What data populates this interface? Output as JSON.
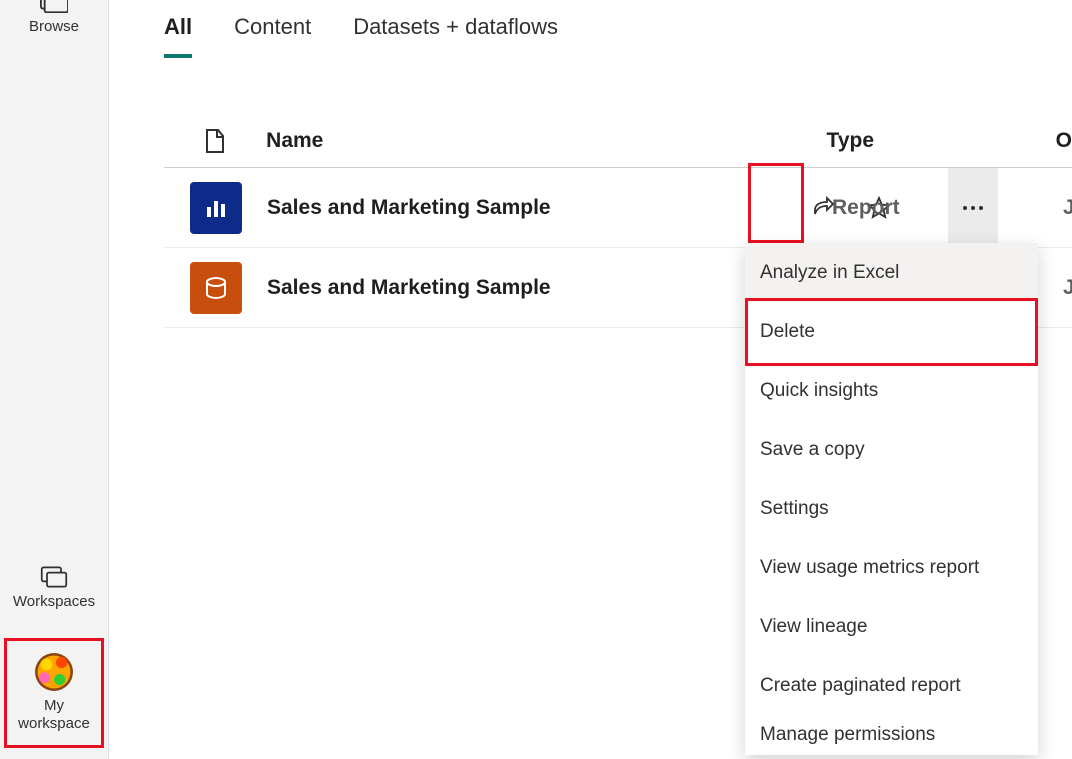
{
  "sidebar": {
    "browse": {
      "label": "Browse"
    },
    "workspaces": {
      "label": "Workspaces"
    },
    "myworkspace": {
      "label": "My workspace"
    }
  },
  "tabs": [
    {
      "label": "All",
      "active": true
    },
    {
      "label": "Content",
      "active": false
    },
    {
      "label": "Datasets + dataflows",
      "active": false
    }
  ],
  "columns": {
    "name": "Name",
    "type": "Type",
    "owner": "O"
  },
  "rows": [
    {
      "name": "Sales and Marketing Sample",
      "type": "Report",
      "owner": "Jo",
      "kind": "report"
    },
    {
      "name": "Sales and Marketing Sample",
      "type": "",
      "owner": "Jo",
      "kind": "dataset"
    }
  ],
  "menu": {
    "items": [
      "Analyze in Excel",
      "Delete",
      "Quick insights",
      "Save a copy",
      "Settings",
      "View usage metrics report",
      "View lineage",
      "Create paginated report",
      "Manage permissions"
    ]
  }
}
